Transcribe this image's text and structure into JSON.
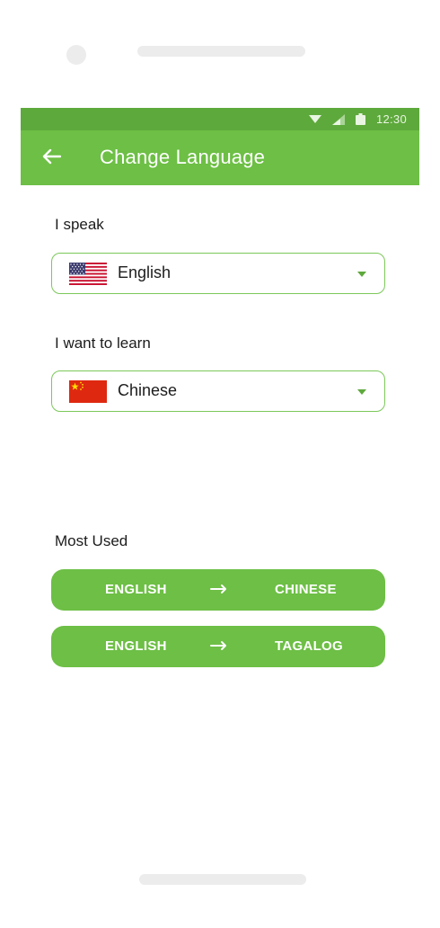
{
  "status_bar": {
    "time": "12:30",
    "icons": [
      "wifi-icon",
      "signal-icon",
      "battery-icon"
    ]
  },
  "app_bar": {
    "back_icon": "arrow-left-icon",
    "title": "Change Language"
  },
  "speak": {
    "label": "I speak",
    "selected": "English",
    "flag_icon": "us-flag-icon"
  },
  "learn": {
    "label": "I want to learn",
    "selected": "Chinese",
    "flag_icon": "china-flag-icon"
  },
  "most_used": {
    "label": "Most Used",
    "pairs": [
      {
        "from": "ENGLISH",
        "to": "CHINESE"
      },
      {
        "from": "ENGLISH",
        "to": "TAGALOG"
      }
    ]
  },
  "colors": {
    "status_bar": "#5ea93c",
    "primary": "#6dbf45",
    "outline": "#7cc85a",
    "text": "#1c1c1c"
  }
}
